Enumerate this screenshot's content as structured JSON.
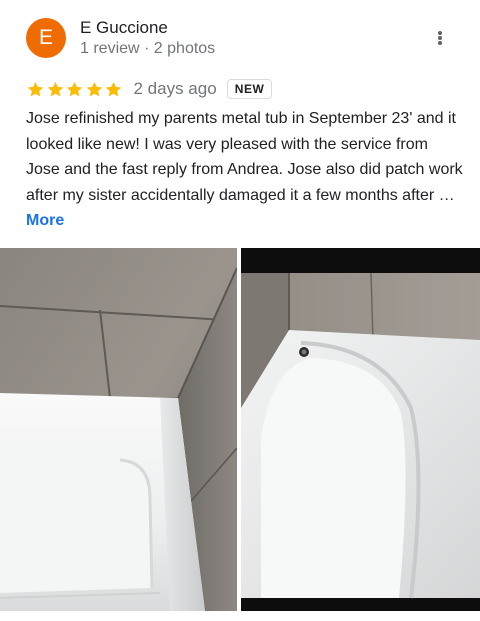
{
  "reviewer": {
    "initial": "E",
    "name": "E Guccione",
    "meta": "1 review · 2 photos",
    "avatar_color": "#ef6c00"
  },
  "rating": {
    "stars": 5,
    "max_stars": 5,
    "star_color": "#fbbc04",
    "date": "2 days ago",
    "badge": "NEW"
  },
  "review": {
    "text": "Jose refinished my parents metal tub in September 23' and it looked like new! I was very pleased with the service from Jose and the fast reply from Andrea. Jose also did patch work after my sister accidentally damaged it a few months after … ",
    "more_label": "More",
    "link_color": "#1a73e8"
  },
  "menu": {
    "icon": "more-vert-icon"
  },
  "photos": [
    {
      "subject": "refinished white bathtub corner with gray tile wall"
    },
    {
      "subject": "refinished white bathtub with drain, gray tile wall"
    }
  ]
}
